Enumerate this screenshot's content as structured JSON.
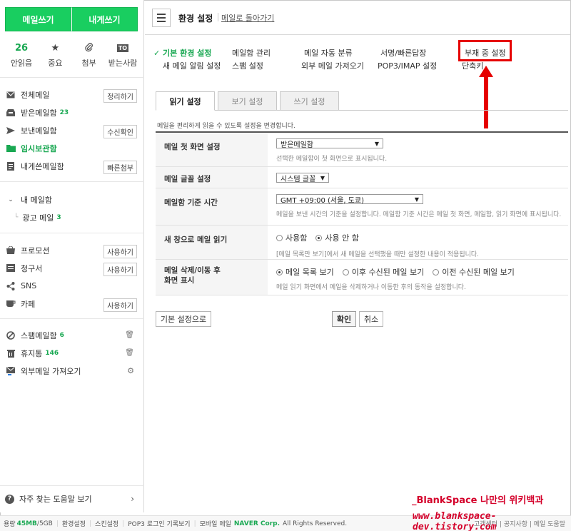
{
  "compose": {
    "write": "메일쓰기",
    "write_self": "내게쓰기"
  },
  "quick": [
    {
      "top": "26",
      "label": "안읽음",
      "icon": "count"
    },
    {
      "top": "★",
      "label": "중요",
      "icon": "star-icon"
    },
    {
      "top": "📎",
      "label": "첨부",
      "icon": "paperclip-icon"
    },
    {
      "top": "TO",
      "label": "받는사람",
      "icon": "to-icon"
    }
  ],
  "folders": [
    {
      "label": "전체메일",
      "button": "정리하기",
      "icon": "all-mail-icon"
    },
    {
      "label": "받은메일함",
      "count": "23",
      "icon": "inbox-icon"
    },
    {
      "label": "보낸메일함",
      "button": "수신확인",
      "icon": "sent-icon"
    },
    {
      "label": "임시보관함",
      "icon": "draft-folder-icon",
      "active": true
    },
    {
      "label": "내게쓴메일함",
      "button": "빠른첨부",
      "icon": "self-mail-icon"
    }
  ],
  "my_folders": {
    "label": "내 메일함",
    "items": [
      {
        "label": "광고 메일",
        "count": "3"
      }
    ]
  },
  "smart": [
    {
      "label": "프로모션",
      "button": "사용하기",
      "icon": "shopping-bag-icon"
    },
    {
      "label": "청구서",
      "button": "사용하기",
      "icon": "bill-icon"
    },
    {
      "label": "SNS",
      "icon": "share-icon"
    },
    {
      "label": "카페",
      "button": "사용하기",
      "icon": "cafe-cup-icon"
    }
  ],
  "system": [
    {
      "label": "스팸메일함",
      "count": "6",
      "icon": "block-icon"
    },
    {
      "label": "휴지통",
      "count": "146",
      "icon": "trash-icon"
    },
    {
      "label": "외부메일 가져오기",
      "icon": "external-mail-icon"
    }
  ],
  "help": {
    "label": "자주 찾는 도움말 보기"
  },
  "topbar": {
    "title": "환경 설정",
    "back_link": "메일로 돌아가기"
  },
  "settings_nav": {
    "col1": [
      "기본 환경 설정",
      "새 메일 알림 설정"
    ],
    "col2": [
      "메일함 관리",
      "스팸 설정"
    ],
    "col3": [
      "메일 자동 분류",
      "외부 메일 가져오기"
    ],
    "col4": [
      "서명/빠른답장",
      "POP3/IMAP 설정"
    ],
    "col5": [
      "부재 중 설정",
      "단축키"
    ]
  },
  "tabs": [
    "읽기 설정",
    "보기 설정",
    "쓰기 설정"
  ],
  "description": "메일을 편리하게 읽을 수 있도록 설정을 변경합니다.",
  "form": {
    "first_screen": {
      "label": "메일 첫 화면 설정",
      "value": "받은메일함",
      "help": "선택한 메일함이 첫 화면으로 표시됩니다."
    },
    "font": {
      "label": "메일 글꼴 설정",
      "value": "시스템 글꼴"
    },
    "timezone": {
      "label": "메일함 기준 시간",
      "value": "GMT +09:00 (서울, 도쿄)",
      "help": "메일을 보낸 시간의 기준을 설정합니다. 메일함 기준 시간은 메일 첫 화면, 메일함, 읽기 화면에 표시됩니다."
    },
    "new_window": {
      "label": "새 창으로 메일 읽기",
      "options": [
        "사용함",
        "사용 안 함"
      ],
      "selected": 1,
      "help": "[메일 목록만 보기]에서 새 메일을 선택했을 때만 설정한 내용이 적용됩니다."
    },
    "after_delete": {
      "label_1": "메일 삭제/이동 후",
      "label_2": "화면 표시",
      "options": [
        "메일 목록 보기",
        "이후 수신된 메일 보기",
        "이전 수신된 메일 보기"
      ],
      "selected": 0,
      "help": "메일 읽기 화면에서 메일을 삭제하거나 이동한 후의 동작을 설정합니다."
    }
  },
  "buttons": {
    "default": "기본 설정으로",
    "ok": "확인",
    "cancel": "취소"
  },
  "footer": {
    "usage_prefix": "용량",
    "usage_used": "45MB",
    "usage_total": "/5GB",
    "links": [
      "환경설정",
      "스킨설정",
      "POP3 로그인 기록보기",
      "모바일 메일"
    ],
    "naver": "NAVER Corp.",
    "rights": "All Rights Reserved.",
    "right": "고객센터 | 공지사항 | 메일 도움말"
  },
  "watermark": {
    "line1": "_BlankSpace 나만의 위키백과",
    "line2": "www.blankspace-dev.tistory.com"
  },
  "colors": {
    "accent": "#19ce60",
    "highlight": "#e60000"
  }
}
